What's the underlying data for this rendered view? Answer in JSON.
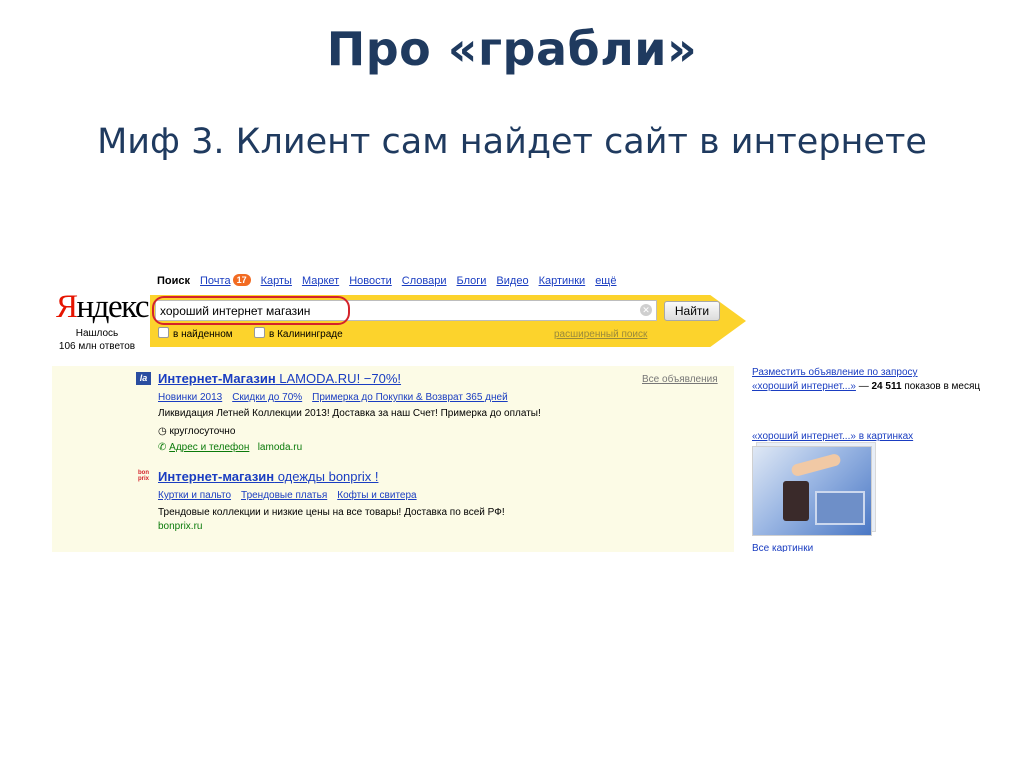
{
  "slide": {
    "title": "Про «грабли»",
    "subtitle": "Миф 3. Клиент сам найдет сайт в интернете"
  },
  "header": {
    "logo_first": "Я",
    "logo_rest": "ндекс",
    "found_line1": "Нашлось",
    "found_line2": "106 млн ответов",
    "nav": {
      "current": "Поиск",
      "mail": "Почта",
      "mail_badge": "17",
      "items": [
        "Карты",
        "Маркет",
        "Новости",
        "Словари",
        "Блоги",
        "Видео",
        "Картинки",
        "ещё"
      ]
    },
    "search": {
      "value": "хороший интернет магазин",
      "button": "Найти",
      "opt_found": "в найденном",
      "opt_city": "в Калининграде",
      "advanced": "расширенный поиск"
    }
  },
  "results": {
    "all_ads": "Все объявления",
    "items": [
      {
        "icon": "la",
        "title_bold": "Интернет-Магазин",
        "title_rest": " LAMODA.RU! −70%!",
        "links": [
          "Новинки 2013",
          "Скидки до 70%",
          "Примерка до Покупки & Возврат 365 дней"
        ],
        "text": "Ликвидация Летней Коллекции 2013! Доставка за наш Счет! Примерка до оплаты!",
        "hours": "круглосуточно",
        "address": "Адрес и телефон",
        "domain": "lamoda.ru"
      },
      {
        "icon": "bon prix",
        "title_bold": "Интернет-магазин",
        "title_rest": " одежды bonprix !",
        "links": [
          "Куртки и пальто",
          "Трендовые платья",
          "Кофты и свитера"
        ],
        "text": "Трендовые коллекции и низкие цены на все товары! Доставка по всей РФ!",
        "domain": "bonprix.ru"
      }
    ]
  },
  "side": {
    "place_ad": "Разместить объявление по запросу",
    "query_link": "«хороший интернет...»",
    "dash": " — ",
    "count": "24 511",
    "count_rest": " показов в месяц",
    "images_link": "«хороший интернет...» в картинках",
    "all_images": "Все картинки"
  },
  "colors": {
    "accent_red": "#d4232b",
    "yandex_yellow": "#fcd32c",
    "link_blue": "#1a3dc1",
    "title_navy": "#1f3a5f"
  }
}
